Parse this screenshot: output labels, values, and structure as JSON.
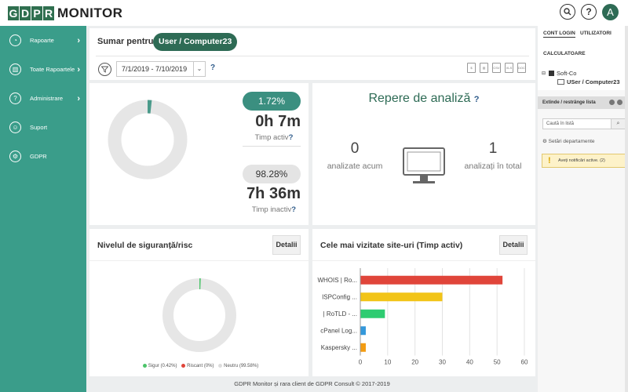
{
  "app": {
    "logo_letters": [
      "G",
      "D",
      "P",
      "R"
    ],
    "logo_word": "MONITOR",
    "avatar_initial": "A"
  },
  "topbar": {
    "search_icon": "search-icon",
    "help_label": "?"
  },
  "sidebar": {
    "items": [
      {
        "label": "Rapoarte",
        "icon": "dashboard-icon",
        "chevron": true
      },
      {
        "label": "Toate Rapoartele",
        "icon": "reports-icon",
        "chevron": true
      },
      {
        "label": "Administrare",
        "icon": "help-circle-icon",
        "chevron": true
      },
      {
        "label": "Suport",
        "icon": "support-icon",
        "chevron": false
      },
      {
        "label": "GDPR",
        "icon": "gdpr-icon",
        "chevron": false
      }
    ]
  },
  "summary": {
    "title": "Sumar pentru",
    "user_pill": "User / Computer23",
    "date_range": "7/1/2019 - 7/10/2019",
    "help": "?"
  },
  "time": {
    "active_pct": "1.72%",
    "active_value": 1.72,
    "active_time": "0h 7m",
    "active_label": "Timp activ",
    "inactive_pct": "98.28%",
    "inactive_time": "7h 36m",
    "inactive_label": "Timp inactiv",
    "q": "?"
  },
  "analysis": {
    "title": "Repere de analiză",
    "q": "?",
    "analyzed_now_num": "0",
    "analyzed_now_label": "analizate acum",
    "analyzed_total_num": "1",
    "analyzed_total_label": "analizați în total"
  },
  "risk": {
    "title": "Nivelul de siguranță/risc",
    "details": "Detalii",
    "legend": [
      {
        "label": "Sigur (0.42%)",
        "color": "#4cc46a",
        "value": 0.42
      },
      {
        "label": "Riscant (0%)",
        "color": "#e0453a",
        "value": 0
      },
      {
        "label": "Neutru (99.58%)",
        "color": "#dddddd",
        "value": 99.58
      }
    ]
  },
  "chart_data": {
    "type": "bar",
    "orientation": "horizontal",
    "title": "Cele mai vizitate site-uri (Timp activ)",
    "categories": [
      "WHOIS | Ro...",
      "ISPConfig ...",
      "| RoTLD - ...",
      "cPanel Log...",
      "Kaspersky ..."
    ],
    "values": [
      52,
      30,
      9,
      2,
      2
    ],
    "colors": [
      "#e0453a",
      "#f2c418",
      "#2ecc71",
      "#3498db",
      "#f39c12"
    ],
    "xticks": [
      0,
      10,
      20,
      30,
      40,
      50,
      60
    ],
    "xlim": [
      0,
      60
    ],
    "grid": true
  },
  "sites": {
    "details": "Detalii"
  },
  "right_panel": {
    "tab_logins": "CONT LOGIN",
    "tab_users": "UTILIZATORI",
    "tab_computers": "CALCULATOARE",
    "tree_root": "Soft-Co",
    "tree_child": "USer / Computer23",
    "expand_label": "Extinde / restrânge lista",
    "search_placeholder": "Caută în listă",
    "dept_settings": "Setări departamente",
    "notif": "Aveți notificări active. (2)",
    "notif_bang": "!"
  },
  "footer": {
    "text": "GDPR Monitor și rara client de GDPR Consult © 2017-2019"
  }
}
